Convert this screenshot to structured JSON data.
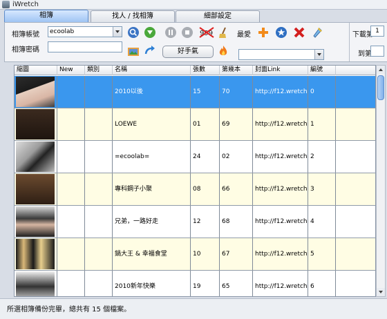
{
  "window": {
    "title": "iWretch"
  },
  "tabs": [
    {
      "label": "相簿",
      "active": true
    },
    {
      "label": "找人 / 找相簿",
      "active": false
    },
    {
      "label": "細部設定",
      "active": false
    }
  ],
  "toolbar": {
    "account_label": "相簿帳號",
    "account_value": "ecoolab",
    "password_label": "相簿密碼",
    "password_value": "",
    "haoshouqi_label": "好手氣",
    "favorites_label": "最愛",
    "favorites_select_value": "",
    "icons": [
      "search-icon",
      "download-icon",
      "pause-icon",
      "stop-icon",
      "no-999-icon",
      "broom-icon",
      "image-folder-icon",
      "refresh-icon",
      "add-icon",
      "star-icon",
      "delete-icon",
      "pin-icon",
      "fire-icon"
    ],
    "no999_text": "999",
    "download_from_label": "下載第",
    "download_from_value": "1",
    "download_to_label": "到第",
    "download_to_value": "",
    "page_label": "頁"
  },
  "table": {
    "columns": [
      "縮圖",
      "New",
      "類別",
      "名稱",
      "張數",
      "第幾本",
      "封面Link",
      "編號"
    ],
    "rows": [
      {
        "name": "2010以後",
        "count": "15",
        "index": "70",
        "link": "http://f12.wretch....",
        "id": "0",
        "style": "sel"
      },
      {
        "name": "LOEWE",
        "count": "01",
        "index": "69",
        "link": "http://f12.wretch....",
        "id": "1",
        "style": "alt"
      },
      {
        "name": "=ecoolab=",
        "count": "24",
        "index": "02",
        "link": "http://f12.wretch....",
        "id": "2",
        "style": ""
      },
      {
        "name": "專科鋼子小聚",
        "count": "08",
        "index": "66",
        "link": "http://f12.wretch....",
        "id": "3",
        "style": "alt"
      },
      {
        "name": "兄弟，一路好走",
        "count": "12",
        "index": "68",
        "link": "http://f12.wretch....",
        "id": "4",
        "style": ""
      },
      {
        "name": "鍋大王 & 幸福食堂",
        "count": "10",
        "index": "67",
        "link": "http://f12.wretch....",
        "id": "5",
        "style": "alt"
      },
      {
        "name": "2010新年快樂",
        "count": "19",
        "index": "65",
        "link": "http://f12.wretch....",
        "id": "6",
        "style": ""
      }
    ]
  },
  "status": {
    "text": "所選相簿備份完畢，總共有 15 個檔案。"
  },
  "colors": {
    "selected_row": "#3a97ee",
    "alt_row": "#fffde4",
    "accent": "#5d8bc9"
  }
}
